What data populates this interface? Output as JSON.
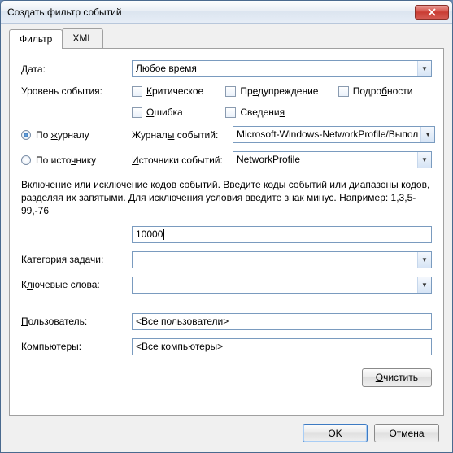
{
  "window": {
    "title": "Создать фильтр событий"
  },
  "tabs": {
    "filter": "Фильтр",
    "xml": "XML"
  },
  "labels": {
    "date": "Дата:",
    "level": "Уровень события:",
    "by_log": "По журналу",
    "by_source": "По источнику",
    "event_logs": "Журналы событий:",
    "event_sources": "Источники событий:",
    "category": "Категория задачи:",
    "keywords": "Ключевые слова:",
    "user": "Пользователь:",
    "computers": "Компьютеры:"
  },
  "date_combo": {
    "value": "Любое время"
  },
  "levels": {
    "critical": "Критическое",
    "warning": "Предупреждение",
    "verbose": "Подробности",
    "error": "Ошибка",
    "info": "Сведения"
  },
  "logs_value": "Microsoft-Windows-NetworkProfile/Выпол",
  "sources_value": "NetworkProfile",
  "help_text": "Включение или исключение кодов событий. Введите коды событий или диапазоны кодов, разделяя их запятыми. Для исключения условия введите знак минус. Например: 1,3,5-99,-76",
  "ids_value": "10000",
  "category_value": "",
  "keywords_value": "",
  "user_value": "<Все пользователи>",
  "computers_value": "<Все компьютеры>",
  "buttons": {
    "clear": "Очистить",
    "ok": "OK",
    "cancel": "Отмена"
  },
  "underlined": {
    "date_u": "Д",
    "date_rest": "ата:",
    "critical_u": "К",
    "critical_rest": "ритическое",
    "warning_pre": "Пр",
    "warning_u": "е",
    "warning_rest": "дупреждение",
    "verbose_pre": "Подро",
    "verbose_u": "б",
    "verbose_rest": "ности",
    "error_u": "О",
    "error_rest": "шибка",
    "info_pre": "Сведени",
    "info_u": "я",
    "bylog_pre": "По ",
    "bylog_u": "ж",
    "bylog_rest": "урналу",
    "bysrc_pre": "По исто",
    "bysrc_u": "ч",
    "bysrc_rest": "нику",
    "logs_pre": "Журнал",
    "logs_u": "ы",
    "logs_rest": " событий:",
    "src_u": "И",
    "src_rest": "сточники событий:",
    "cat_pre": "Категория ",
    "cat_u": "з",
    "cat_rest": "адачи:",
    "kw_pre": "К",
    "kw_u": "л",
    "kw_rest": "ючевые слова:",
    "user_u": "П",
    "user_rest": "ользователь:",
    "comp_pre": "Компь",
    "comp_u": "ю",
    "comp_rest": "теры:",
    "clear_u": "О",
    "clear_rest": "чистить"
  }
}
